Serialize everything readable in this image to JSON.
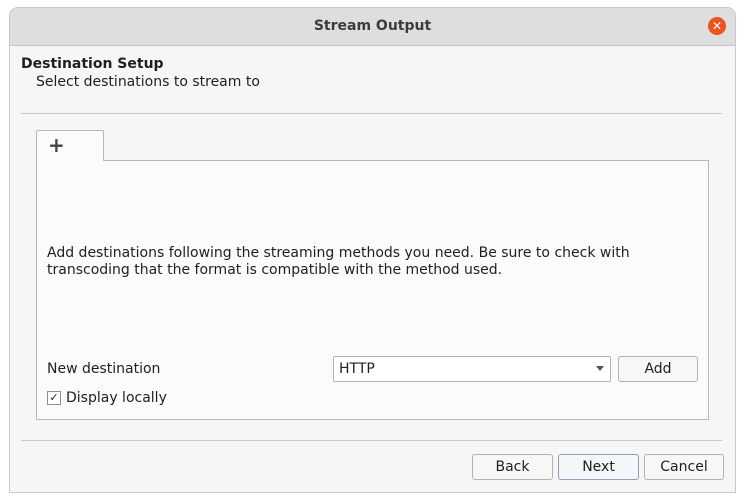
{
  "window": {
    "title": "Stream Output",
    "close_glyph": "✕"
  },
  "header": {
    "heading": "Destination Setup",
    "subheading": "Select destinations to stream to"
  },
  "tabs": [
    {
      "label": "+",
      "icon": "plus-icon"
    }
  ],
  "panel": {
    "description": "Add destinations following the streaming methods you need. Be sure to check with transcoding that the format is compatible with the method used.",
    "new_destination_label": "New destination",
    "destination_select": {
      "selected": "HTTP"
    },
    "add_label": "Add",
    "display_locally": {
      "label": "Display locally",
      "checked": true,
      "check_glyph": "✓"
    }
  },
  "footer": {
    "back_label": "Back",
    "next_label": "Next",
    "cancel_label": "Cancel"
  },
  "colors": {
    "accent_close": "#e95420",
    "window_bg": "#f6f6f6",
    "titlebar_bg": "#dedede"
  }
}
